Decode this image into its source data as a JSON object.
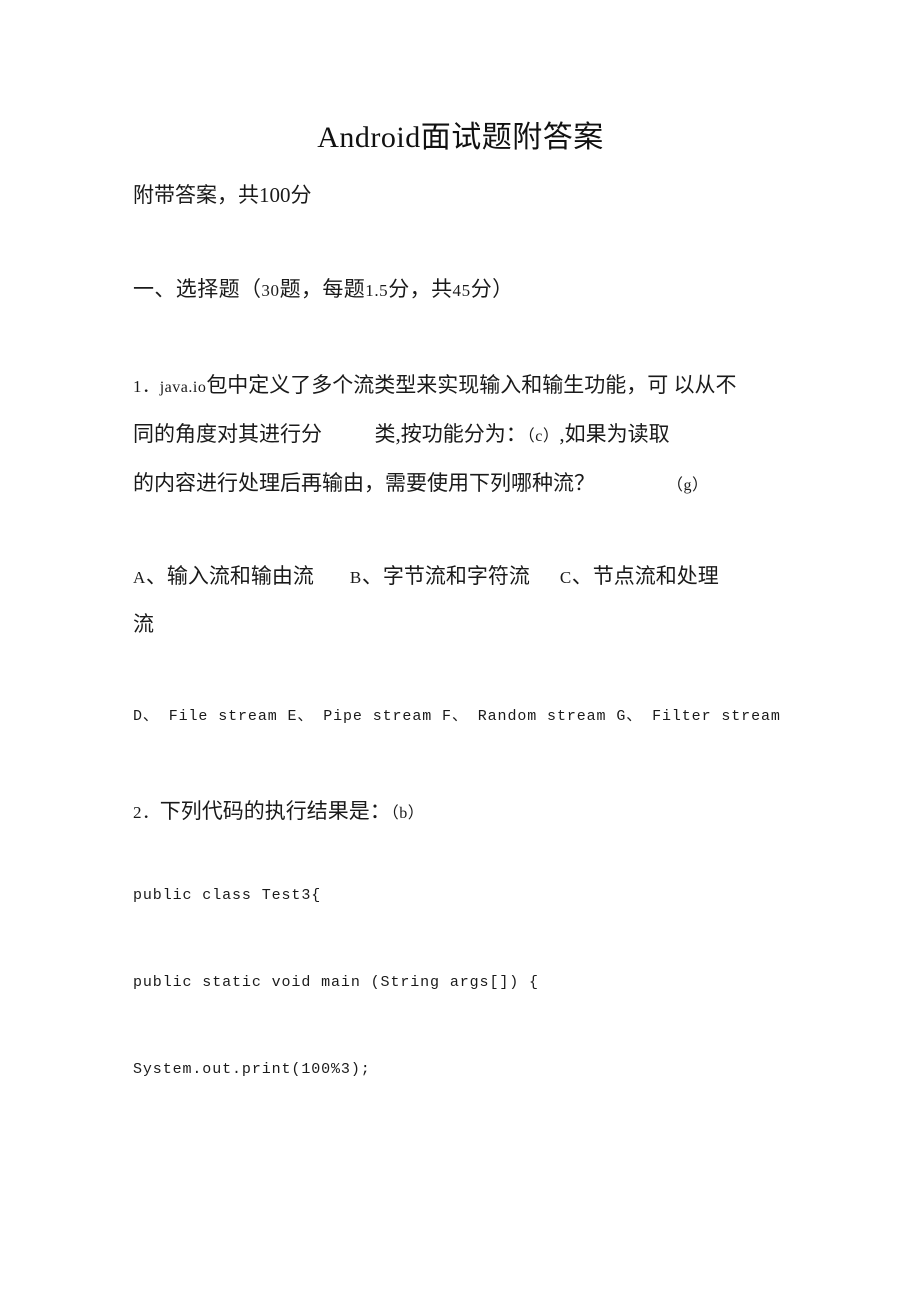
{
  "document": {
    "title": "Android面试题附答案",
    "subtitle": "附带答案，共100分",
    "background_color": "#ffffff",
    "text_color": "#1a1a1a"
  },
  "section": {
    "heading_prefix": "一、选择题（",
    "heading_count": "30",
    "heading_mid1": "题，每题",
    "heading_per": "1.5",
    "heading_mid2": "分，共",
    "heading_total": "45",
    "heading_suffix": "分）",
    "heading_full": "一、选择题（30题，每题1.5分，共45分）"
  },
  "questions": [
    {
      "number": "1",
      "number_sep": "．",
      "stem_latin": "java.io",
      "line1_rest": "包中定义了多个流类型来实现输入和输生功能，可 以从不",
      "line2": "同的角度对其进行分          类,按功能分为：",
      "line2_answer": "（c）",
      "line2_tail": ",如果为读取",
      "line3": "的内容进行处理后再输由，需要使用下列哪种流？",
      "line3_answer": "（g）",
      "options_cn": [
        {
          "letter": "A",
          "sep": "、",
          "text": "输入流和输由流"
        },
        {
          "letter": "B",
          "sep": "、",
          "text": "字节流和字符流"
        },
        {
          "letter": "C",
          "sep": "、",
          "text": "节点流和处理"
        }
      ],
      "options_cn_wrap": "流",
      "options_en": "D、 File stream E、 Pipe stream F、 Random stream G、 Filter stream"
    },
    {
      "number": "2",
      "number_sep": "．",
      "stem": "下列代码的执行结果是：",
      "answer": "（b）",
      "code": [
        "public class Test3{",
        "public static void main (String args[]) {",
        "System.out.print(100%3);"
      ]
    }
  ]
}
